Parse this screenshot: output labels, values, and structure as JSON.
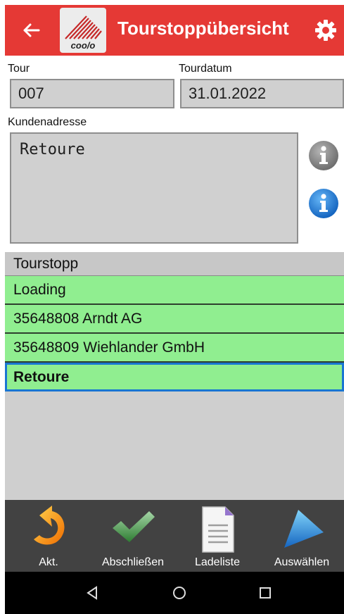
{
  "header": {
    "title": "Tourstoppübersicht",
    "logo_text": "coo/o",
    "back_icon": "arrow-left-icon",
    "settings_icon": "gear-icon",
    "color": "#e53935"
  },
  "tour": {
    "label": "Tour",
    "value": "007"
  },
  "tourdatum": {
    "label": "Tourdatum",
    "value": "31.01.2022"
  },
  "kundenadresse": {
    "label": "Kundenadresse",
    "value": "Retoure"
  },
  "info_buttons": [
    {
      "icon": "info-gray-icon"
    },
    {
      "icon": "info-blue-icon"
    }
  ],
  "tourstopp": {
    "header": "Tourstopp",
    "items": [
      "Loading",
      "35648808 Arndt AG",
      "35648809 Wiehlander GmbH",
      "Retoure"
    ],
    "selected": "Retoure",
    "row_color": "#90ee90"
  },
  "toolbar": {
    "buttons": [
      {
        "label": "Akt.",
        "icon": "refresh-arrow-icon"
      },
      {
        "label": "Abschließen",
        "icon": "checkmark-icon"
      },
      {
        "label": "Ladeliste",
        "icon": "document-list-icon"
      },
      {
        "label": "Auswählen",
        "icon": "play-arrow-icon"
      }
    ]
  },
  "navbar": {
    "icons": [
      "back-triangle-icon",
      "home-circle-icon",
      "recents-square-icon"
    ]
  }
}
